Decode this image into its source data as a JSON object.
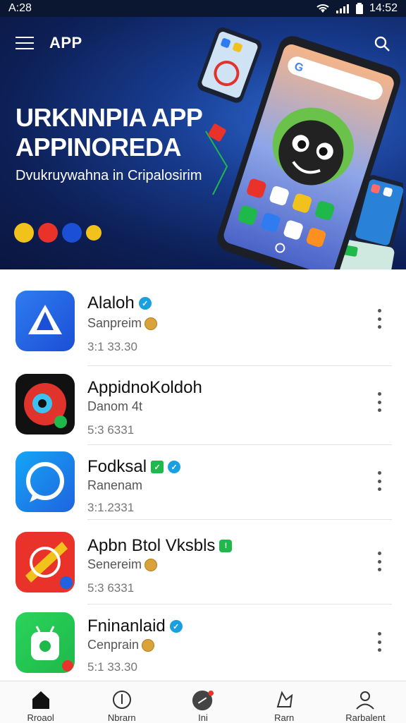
{
  "status": {
    "time": "A:28",
    "clock": "14:52"
  },
  "hero": {
    "brand": "APP",
    "title_line1": "URKNNPIA APP",
    "title_line2": "APPINOREDA",
    "subtitle": "Dvukruywahna in Cripalosirim"
  },
  "apps": [
    {
      "name": "Alaloh",
      "developer": "Sanpreim",
      "meta": "3:1 33.30",
      "badge": "verified",
      "icon_colors": [
        "#1b4fd6",
        "#2f7cf0"
      ]
    },
    {
      "name": "AppidnoKoldoh",
      "developer": "Danom 4t",
      "meta": "5:3 6331",
      "badge": "",
      "icon_colors": [
        "#111111",
        "#e0332b"
      ]
    },
    {
      "name": "Fodksal",
      "developer": "Ranenam",
      "meta": "3:1.2331",
      "badge": "verified",
      "icon_colors": [
        "#0a8ff0",
        "#1f63e0"
      ]
    },
    {
      "name": "Apbn Btol Vksbls",
      "developer": "Senereim",
      "meta": "5:3 6331",
      "badge": "secure",
      "icon_colors": [
        "#e8322a",
        "#f0c21b"
      ]
    },
    {
      "name": "Fninanlaid",
      "developer": "Cenprain",
      "meta": "5:1 33.30",
      "badge": "verified",
      "icon_colors": [
        "#1fb84a",
        "#2ad45a"
      ]
    }
  ],
  "nav": [
    {
      "label": "Rroaol",
      "icon": "home-icon",
      "active": true
    },
    {
      "label": "Nbrarn",
      "icon": "compass-icon",
      "active": false
    },
    {
      "label": "Ini",
      "icon": "chat-icon",
      "active": false
    },
    {
      "label": "Rarn",
      "icon": "trophy-icon",
      "active": false
    },
    {
      "label": "Rarbalent",
      "icon": "person-icon",
      "active": false
    }
  ]
}
